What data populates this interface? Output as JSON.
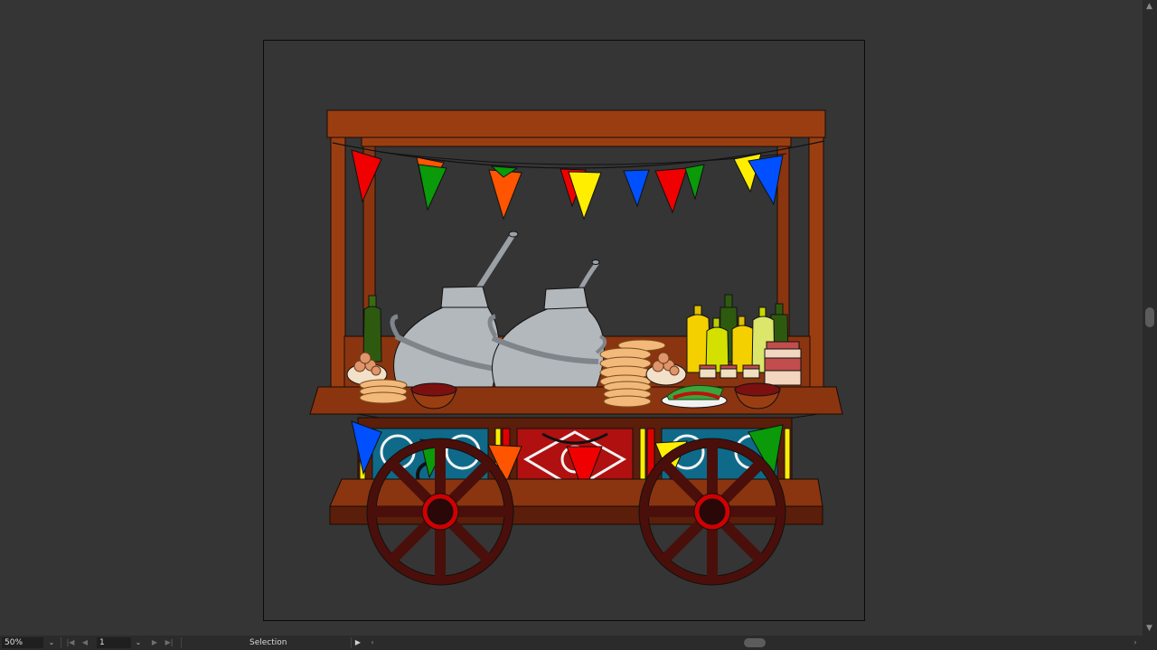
{
  "status_bar": {
    "zoom": "50%",
    "page": "1",
    "tool": "Selection"
  },
  "icons": {
    "zoom_dropdown": "chevron-down-icon",
    "page_dropdown": "chevron-down-icon",
    "first": "first-page-icon",
    "prev": "prev-page-icon",
    "next": "next-page-icon",
    "last": "last-page-icon",
    "status_menu": "play-right-icon",
    "scroll_left": "chevron-left-icon",
    "scroll_right": "chevron-right-icon"
  },
  "colors": {
    "workspace": "#353535",
    "wood": "#9a3e12",
    "wood_dark": "#5a1e0a",
    "flag_red": "#f00000",
    "flag_green": "#0a9a0a",
    "flag_blue": "#0050ff",
    "flag_yellow": "#ffee00",
    "flag_orange": "#ff5500",
    "pot": "#b3b8bd"
  }
}
